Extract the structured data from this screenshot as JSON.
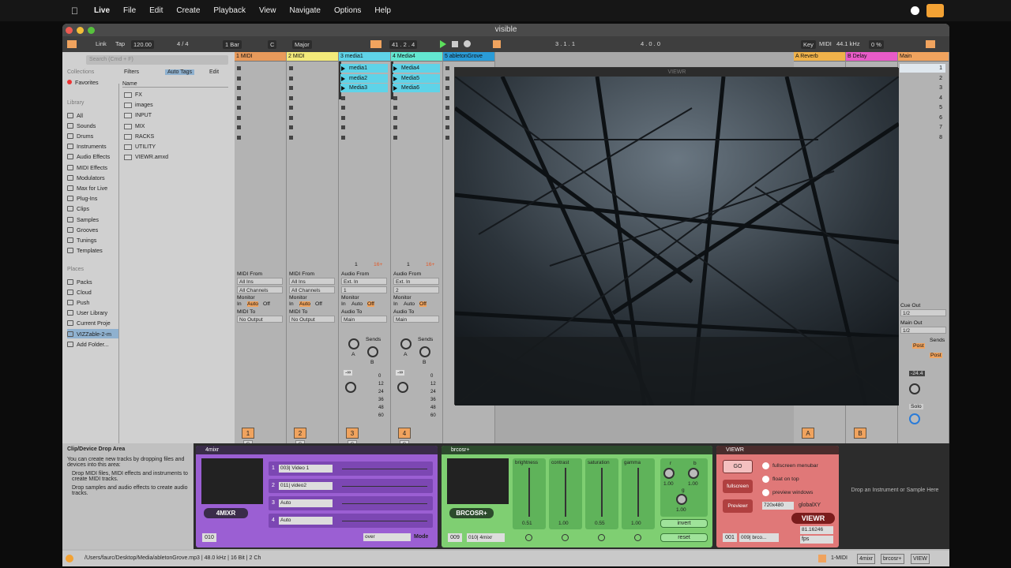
{
  "menubar": {
    "app": "Live",
    "items": [
      "File",
      "Edit",
      "Create",
      "Playback",
      "View",
      "Navigate",
      "Options",
      "Help"
    ]
  },
  "window": {
    "title": "visible"
  },
  "control": {
    "link": "Link",
    "tap": "Tap",
    "tempo": "120.00",
    "signature": "4 / 4",
    "quant": "1 Bar",
    "key": "C",
    "scale": "Major",
    "position": "41 .  2 .  4",
    "loop_start": "3 .  1 .  1",
    "loop_len": "4 .  0 .  0",
    "key_btn": "Key",
    "midi_btn": "MIDI",
    "sample_rate": "44.1 kHz",
    "cpu": "0 %"
  },
  "browser": {
    "search_placeholder": "Search (Cmd + F)",
    "filters": "Filters",
    "auto_tags": "Auto Tags",
    "edit": "Edit",
    "collections_head": "Collections",
    "favorites": "Favorites",
    "library_head": "Library",
    "library": [
      "All",
      "Sounds",
      "Drums",
      "Instruments",
      "Audio Effects",
      "MIDI Effects",
      "Modulators",
      "Max for Live",
      "Plug-Ins",
      "Clips",
      "Samples",
      "Grooves",
      "Tunings",
      "Templates"
    ],
    "places_head": "Places",
    "places": [
      "Packs",
      "Cloud",
      "Push",
      "User Library",
      "Current Proje",
      "VIZZable-2-m",
      "Add Folder..."
    ],
    "name_head": "Name",
    "files": [
      "FX",
      "images",
      "INPUT",
      "MIX",
      "RACKS",
      "UTILITY",
      "VIEWR.amxd"
    ]
  },
  "tracks": [
    {
      "name": "1 MIDI",
      "color": "#e89a5b",
      "num": "1",
      "from_label": "MIDI From",
      "from": "All Ins",
      "chan": "All Channels",
      "to_label": "MIDI To",
      "to": "No Output"
    },
    {
      "name": "2 MIDI",
      "color": "#f3ea7a",
      "num": "2",
      "from_label": "MIDI From",
      "from": "All Ins",
      "chan": "All Channels",
      "to_label": "MIDI To",
      "to": "No Output"
    },
    {
      "name": "3 media1",
      "color": "#5fd3e8",
      "num": "3",
      "from_label": "Audio From",
      "from": "Ext. In",
      "chan": "1",
      "to_label": "Audio To",
      "to": "Main",
      "clips": [
        "media1",
        "media2",
        "Media3"
      ]
    },
    {
      "name": "4 Media4",
      "color": "#63e6d0",
      "num": "4",
      "from_label": "Audio From",
      "from": "Ext. In",
      "chan": "2",
      "to_label": "Audio To",
      "to": "Main",
      "clips": [
        "Media4",
        "Media5",
        "Media6"
      ]
    },
    {
      "name": "5 abletonGrove",
      "color": "#2a9cd8",
      "num": "5"
    }
  ],
  "monitor": {
    "label": "Monitor",
    "in": "In",
    "auto": "Auto",
    "off": "Off"
  },
  "clip_bar": {
    "count": "1",
    "tag": "16+"
  },
  "mixer": {
    "sends": "Sends",
    "a": "A",
    "b": "B",
    "vol": "-∞",
    "db": [
      "0",
      "12",
      "24",
      "36",
      "48",
      "60"
    ]
  },
  "returns": [
    {
      "name": "A Reverb",
      "color": "#f0b24a",
      "letter": "A"
    },
    {
      "name": "B Delay",
      "color": "#e85bc8",
      "letter": "B"
    }
  ],
  "main": {
    "name": "Main",
    "slots": [
      "1",
      "2",
      "3",
      "4",
      "5",
      "6",
      "7",
      "8"
    ],
    "cue_out": "Cue Out",
    "cue_val": "1/2",
    "main_out": "Main Out",
    "main_val": "1/2",
    "post": "Post",
    "vol": "-24.4",
    "solo": "Solo"
  },
  "viewr_window": {
    "title": "VIEWR"
  },
  "drop_area": {
    "title": "Clip/Device Drop Area",
    "lines": [
      "You can create new tracks by dropping files and devices into this area:",
      "Drop MIDI files, MIDI effects and instruments to create MIDI tracks.",
      "Drop samples and audio effects to create audio tracks."
    ]
  },
  "mixr": {
    "title": "4mixr",
    "logo": "4MIXR",
    "channels": [
      {
        "n": "1",
        "src": "003| Video 1"
      },
      {
        "n": "2",
        "src": "011| video2"
      },
      {
        "n": "3",
        "src": "Auto"
      },
      {
        "n": "4",
        "src": "Auto"
      }
    ],
    "id": "010",
    "blend": "over",
    "mode": "Mode"
  },
  "brcosr": {
    "title": "brcosr+",
    "logo": "BRCOSR+",
    "id": "009",
    "src": "010| 4mixr",
    "params": [
      {
        "name": "brightness",
        "val": "0.51"
      },
      {
        "name": "contrast",
        "val": "1.00"
      },
      {
        "name": "saturation",
        "val": "0.55"
      },
      {
        "name": "gamma",
        "val": "1.00"
      }
    ],
    "r": "r",
    "g": "g",
    "b": "b",
    "rv": "1.00",
    "gv": "1.00",
    "bv": "1.00",
    "invert": "invert",
    "reset": "reset"
  },
  "viewr": {
    "title": "VIEWR",
    "go": "GO",
    "fullscreen": "fullscreen",
    "previewr": "Previewr",
    "opts": [
      "fullscreen menubar",
      "float on top",
      "preview windows"
    ],
    "res": "720x480",
    "global": "globalXY",
    "logo": "VIEWR",
    "id": "001",
    "src": "009| brco...",
    "fps_val": "81.16246",
    "fps": "fps"
  },
  "instrument_drop": "Drop an Instrument or Sample Here",
  "status": {
    "path": "/Users/faurc/Desktop/Media/abletonGrove.mp3 | 48.0 kHz | 16 Bit | 2 Ch",
    "track": "1-MIDI",
    "chain": [
      "4mixr",
      "brcosr+",
      "VIEW"
    ]
  }
}
